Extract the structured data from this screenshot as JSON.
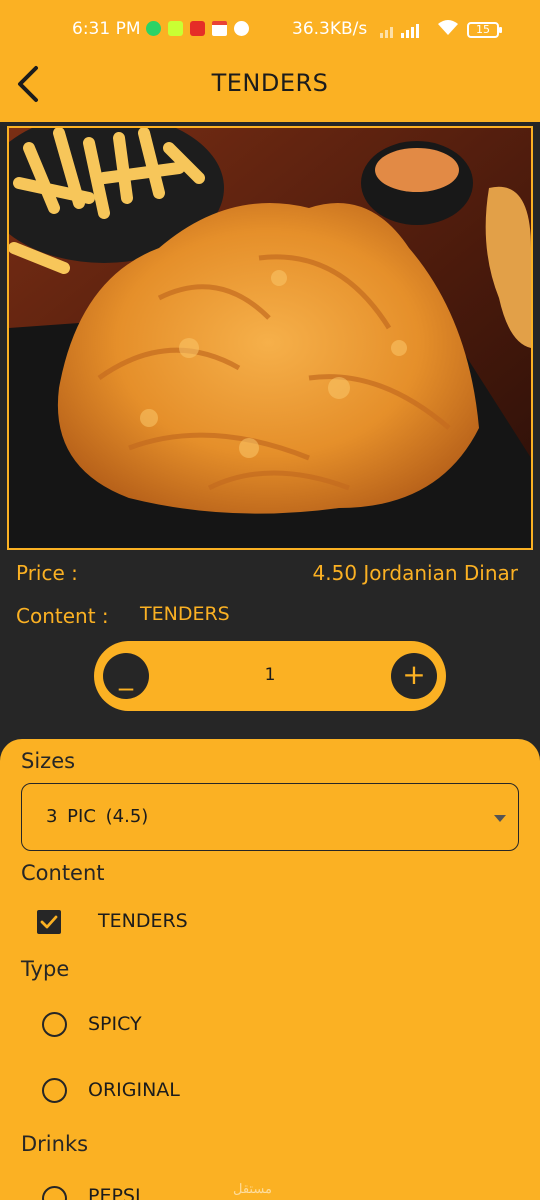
{
  "status_bar": {
    "time": "6:31 PM",
    "network_speed": "36.3KB/s",
    "battery": "15",
    "icons": [
      "whatsapp-icon",
      "app-icon",
      "youtube-icon",
      "gmail-icon",
      "notification-icon",
      "signal-icon",
      "wifi-icon",
      "battery-icon"
    ]
  },
  "app_bar": {
    "title": "TENDERS",
    "back_icon": "chevron-left-icon"
  },
  "product": {
    "image_alt": "tenders-photo",
    "price_label": "Price :",
    "price_value": "4.50  Jordanian Dinar",
    "content_label": "Content :",
    "content_value": "TENDERS"
  },
  "quantity": {
    "minus_label": "_",
    "value": "1",
    "plus_label": "+"
  },
  "options": {
    "sizes_title": "Sizes",
    "size_selected": "3 PIC   (4.5)",
    "content_title": "Content",
    "content_items": [
      {
        "label": "TENDERS",
        "checked": true
      }
    ],
    "type_title": "Type",
    "type_items": [
      {
        "label": "SPICY",
        "selected": false
      },
      {
        "label": "ORIGINAL",
        "selected": false
      }
    ],
    "drinks_title": "Drinks",
    "drink_items": [
      {
        "label": "PEPSI",
        "selected": false
      }
    ]
  },
  "colors": {
    "accent": "#FBB123",
    "dark": "#262626"
  },
  "watermark": "مستقل"
}
